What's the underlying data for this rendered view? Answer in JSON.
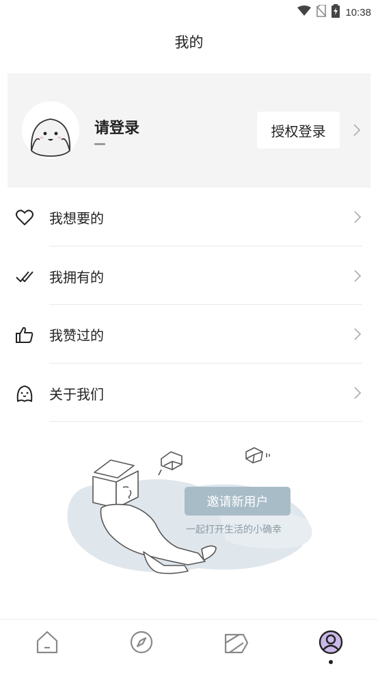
{
  "status_bar": {
    "time": "10:38",
    "icons": [
      "wifi-icon",
      "no-sim-icon",
      "battery-charging-icon"
    ]
  },
  "header": {
    "title": "我的"
  },
  "profile": {
    "prompt": "请登录",
    "subtitle": "—",
    "authorize_label": "授权登录"
  },
  "menu": {
    "items": [
      {
        "label": "我想要的",
        "icon": "heart-icon"
      },
      {
        "label": "我拥有的",
        "icon": "double-check-icon"
      },
      {
        "label": "我赞过的",
        "icon": "thumbs-up-icon"
      },
      {
        "label": "关于我们",
        "icon": "ghost-icon"
      }
    ]
  },
  "invite": {
    "button_label": "邀请新用户",
    "subtitle": "一起打开生活的小确幸"
  },
  "tab_bar": {
    "tabs": [
      {
        "icon": "home-icon",
        "active": false
      },
      {
        "icon": "compass-icon",
        "active": false
      },
      {
        "icon": "box-icon",
        "active": false
      },
      {
        "icon": "profile-icon",
        "active": true
      }
    ]
  },
  "colors": {
    "card_background": "#f4f4f4",
    "invite_button": "#a8bcc8",
    "divider": "#e8e8e8",
    "active_tab_fill": "#c9b8e8"
  }
}
